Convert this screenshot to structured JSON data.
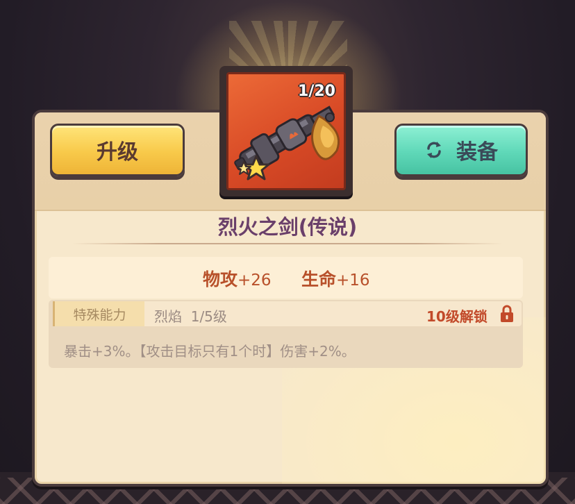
{
  "item": {
    "count": "1/20",
    "name": "烈火之剑(传说)"
  },
  "buttons": {
    "upgrade": "升级",
    "equip": "装备"
  },
  "stats": {
    "attack": {
      "label": "物攻",
      "value": "+26"
    },
    "hp": {
      "label": "生命",
      "value": "+16"
    }
  },
  "ability": {
    "tag": "特殊能力",
    "name": "烈焰  1/5级",
    "unlock": "10级解锁",
    "description": "暴击+3%。【攻击目标只有1个时】伤害+2%。"
  },
  "colors": {
    "upgrade_button": "#f8c94a",
    "equip_button": "#5fd8b8",
    "item_background": "#d84a26",
    "title": "#6a3f6a",
    "stat_text": "#b8502a",
    "unlock_text": "#c24a2a"
  },
  "icons": {
    "equip": "refresh-icon",
    "lock": "lock-icon",
    "item": "flame-sword-icon",
    "rarity": "star-icon"
  }
}
